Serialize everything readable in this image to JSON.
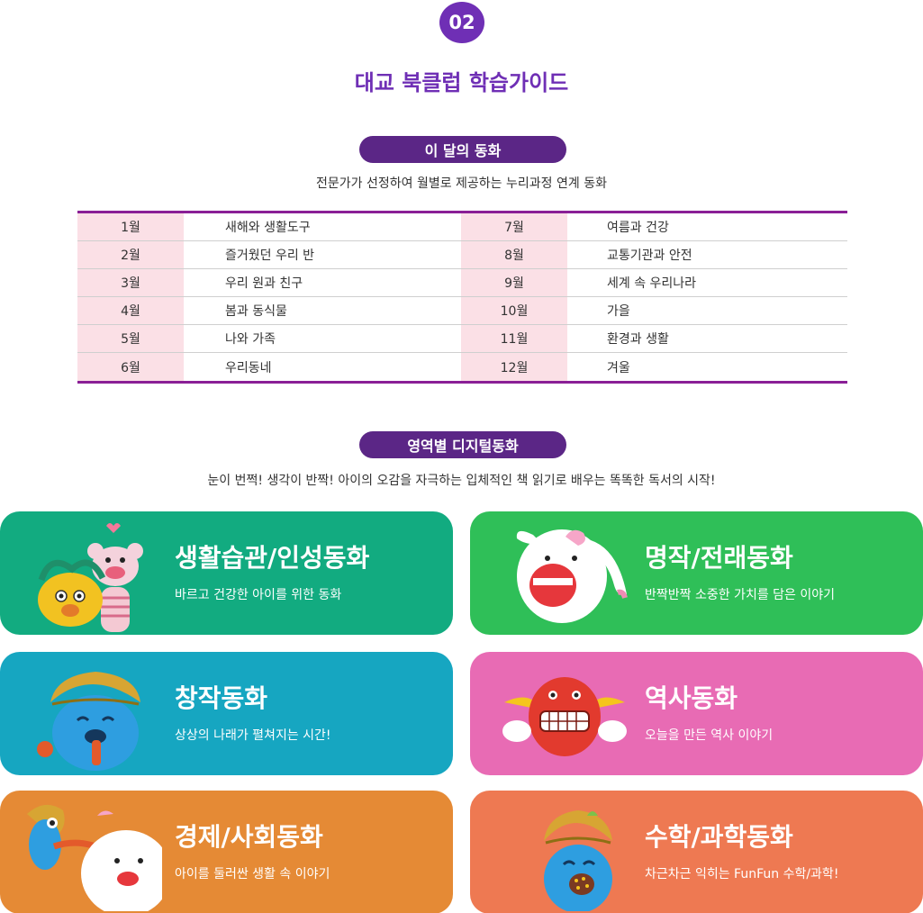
{
  "header": {
    "step": "02",
    "title": "대교 북클럽 학습가이드"
  },
  "monthly": {
    "badge": "이 달의 동화",
    "subtitle": "전문가가 선정하여 월별로 제공하는 누리과정 연계 동화",
    "rows": [
      {
        "m1": "1월",
        "t1": "새해와 생활도구",
        "m2": "7월",
        "t2": "여름과 건강"
      },
      {
        "m1": "2월",
        "t1": "즐거웠던 우리 반",
        "m2": "8월",
        "t2": "교통기관과 안전"
      },
      {
        "m1": "3월",
        "t1": "우리 원과 친구",
        "m2": "9월",
        "t2": "세계 속 우리나라"
      },
      {
        "m1": "4월",
        "t1": "봄과 동식물",
        "m2": "10월",
        "t2": "가을"
      },
      {
        "m1": "5월",
        "t1": "나와 가족",
        "m2": "11월",
        "t2": "환경과 생활"
      },
      {
        "m1": "6월",
        "t1": "우리동네",
        "m2": "12월",
        "t2": "겨울"
      }
    ]
  },
  "digital": {
    "badge": "영역별 디지털동화",
    "subtitle": "눈이 번쩍! 생각이 반짝! 아이의 오감을 자극하는 입체적인 책 읽기로 배우는 똑똑한 독서의 시작!",
    "cards": [
      {
        "title": "생활습관/인성동화",
        "desc": "바르고 건강한 아이를 위한 동화",
        "color": "#12ab80"
      },
      {
        "title": "명작/전래동화",
        "desc": "반짝반짝 소중한 가치를 담은 이야기",
        "color": "#2fbf58"
      },
      {
        "title": "창작동화",
        "desc": "상상의 나래가 펼쳐지는 시간!",
        "color": "#16a6c1"
      },
      {
        "title": "역사동화",
        "desc": "오늘을 만든 역사 이야기",
        "color": "#e86bb4"
      },
      {
        "title": "경제/사회동화",
        "desc": "아이를 둘러싼 생활 속 이야기",
        "color": "#e58a35"
      },
      {
        "title": "수학/과학동화",
        "desc": "차근차근 익히는 FunFun 수학/과학!",
        "color": "#ee7952"
      }
    ]
  },
  "colors": {
    "accent": "#6f2fb5",
    "pill": "#5b2686",
    "table_border": "#8a1f96",
    "month_bg": "#fbe0e6"
  }
}
